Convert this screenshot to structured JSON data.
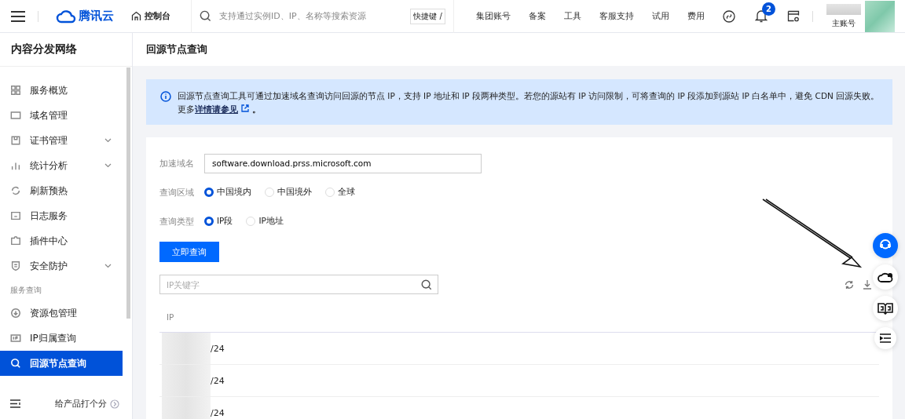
{
  "topbar": {
    "brand": "腾讯云",
    "console": "控制台",
    "search_placeholder": "支持通过实例ID、IP、名称等搜索资源",
    "shortcut": "快捷键 /",
    "nav": [
      "集团账号",
      "备案",
      "工具",
      "客服支持",
      "试用",
      "费用"
    ],
    "notification_count": "2",
    "account": "主账号"
  },
  "sidebar": {
    "title": "内容分发网络",
    "items": [
      {
        "label": "服务概览",
        "has_submenu": false,
        "selected": false
      },
      {
        "label": "域名管理",
        "has_submenu": false,
        "selected": false
      },
      {
        "label": "证书管理",
        "has_submenu": true,
        "selected": false
      },
      {
        "label": "统计分析",
        "has_submenu": true,
        "selected": false
      },
      {
        "label": "刷新预热",
        "has_submenu": false,
        "selected": false
      },
      {
        "label": "日志服务",
        "has_submenu": false,
        "selected": false
      },
      {
        "label": "插件中心",
        "has_submenu": false,
        "selected": false
      },
      {
        "label": "安全防护",
        "has_submenu": true,
        "selected": false
      }
    ],
    "section": "服务查询",
    "section_items": [
      {
        "label": "资源包管理",
        "has_submenu": false,
        "selected": false
      },
      {
        "label": "IP归属查询",
        "has_submenu": false,
        "selected": false
      },
      {
        "label": "回源节点查询",
        "has_submenu": false,
        "selected": true
      }
    ],
    "feedback": "给产品打个分"
  },
  "page": {
    "title": "回源节点查询",
    "notice": {
      "text": "回源节点查询工具可通过加速域名查询访问回源的节点 IP，支持 IP 地址和 IP 段两种类型。若您的源站有 IP 访问限制，可将查询的 IP 段添加到源站 IP 白名单中，避免 CDN 回源失败。更多",
      "link": "详情请参见",
      "tail": "。"
    },
    "form": {
      "domain_label": "加速域名",
      "domain_value": "software.download.prss.microsoft.com",
      "region_label": "查询区域",
      "region_options": [
        {
          "label": "中国境内",
          "selected": true
        },
        {
          "label": "中国境外",
          "selected": false
        },
        {
          "label": "全球",
          "selected": false
        }
      ],
      "type_label": "查询类型",
      "type_options": [
        {
          "label": "IP段",
          "selected": true
        },
        {
          "label": "IP地址",
          "selected": false
        }
      ],
      "submit": "立即查询"
    },
    "filter_placeholder": "IP关键字",
    "table": {
      "columns": [
        "IP"
      ],
      "rows": [
        [
          "/24"
        ],
        [
          "/24"
        ],
        [
          "/24"
        ]
      ]
    }
  }
}
